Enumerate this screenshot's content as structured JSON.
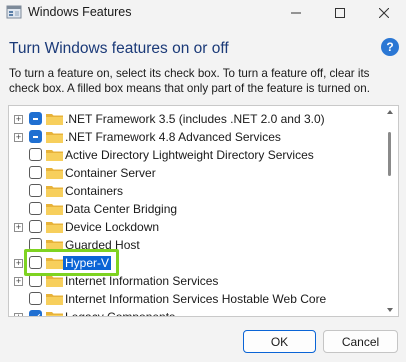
{
  "window": {
    "title": "Windows Features",
    "app_icon": "windows-features-icon"
  },
  "heading": "Turn Windows features on or off",
  "description": "To turn a feature on, select its check box. To turn a feature off, clear its check box. A filled box means that only part of the feature is turned on.",
  "features": [
    {
      "label": ".NET Framework 3.5 (includes .NET 2.0 and 3.0)",
      "expandable": true,
      "state": "partial"
    },
    {
      "label": ".NET Framework 4.8 Advanced Services",
      "expandable": true,
      "state": "partial"
    },
    {
      "label": "Active Directory Lightweight Directory Services",
      "expandable": false,
      "state": "unchecked"
    },
    {
      "label": "Container Server",
      "expandable": false,
      "state": "unchecked"
    },
    {
      "label": "Containers",
      "expandable": false,
      "state": "unchecked"
    },
    {
      "label": "Data Center Bridging",
      "expandable": false,
      "state": "unchecked"
    },
    {
      "label": "Device Lockdown",
      "expandable": true,
      "state": "unchecked"
    },
    {
      "label": "Guarded Host",
      "expandable": false,
      "state": "unchecked"
    },
    {
      "label": "Hyper-V",
      "expandable": true,
      "state": "unchecked",
      "selected": true
    },
    {
      "label": "Internet Information Services",
      "expandable": true,
      "state": "unchecked"
    },
    {
      "label": "Internet Information Services Hostable Web Core",
      "expandable": false,
      "state": "unchecked"
    },
    {
      "label": "Legacy Components",
      "expandable": true,
      "state": "checked"
    }
  ],
  "buttons": {
    "ok": "OK",
    "cancel": "Cancel"
  },
  "colors": {
    "accent": "#1f6fd1",
    "selection": "#0a64d6",
    "highlight_annotation": "#7ed321",
    "heading": "#1b3a78"
  }
}
